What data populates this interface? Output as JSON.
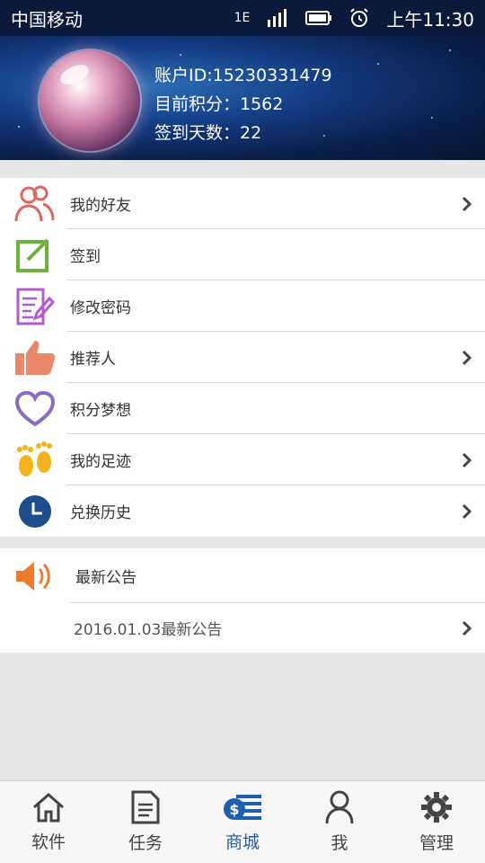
{
  "status_bar": {
    "carrier": "中国移动",
    "network": "1E",
    "time": "上午11:30"
  },
  "account": {
    "id_line": "账户ID:15230331479",
    "points_line": "目前积分：1562",
    "signin_days_line": "签到天数：22"
  },
  "menu": {
    "items": [
      {
        "label": "我的好友",
        "icon": "friends-icon",
        "chevron": true
      },
      {
        "label": "签到",
        "icon": "checkin-icon",
        "chevron": false
      },
      {
        "label": "修改密码",
        "icon": "edit-document-icon",
        "chevron": false
      },
      {
        "label": "推荐人",
        "icon": "thumbs-up-icon",
        "chevron": true
      },
      {
        "label": "积分梦想",
        "icon": "heart-icon",
        "chevron": false
      },
      {
        "label": "我的足迹",
        "icon": "footprints-icon",
        "chevron": true
      },
      {
        "label": "兑换历史",
        "icon": "clock-icon",
        "chevron": true
      }
    ]
  },
  "announcement": {
    "title": "最新公告",
    "latest": "2016.01.03最新公告"
  },
  "bottom_nav": {
    "items": [
      {
        "label": "软件",
        "icon": "home-icon"
      },
      {
        "label": "任务",
        "icon": "document-icon"
      },
      {
        "label": "商城",
        "icon": "shop-icon"
      },
      {
        "label": "我",
        "icon": "person-icon"
      },
      {
        "label": "管理",
        "icon": "gear-icon"
      }
    ],
    "active": "商城"
  },
  "colors": {
    "accent": "#1e5fb3",
    "friends": "#e0655f",
    "checkin": "#6bb33a",
    "edit": "#b25bd0",
    "thumb": "#e9896b",
    "heart": "#8c6ac0",
    "feet": "#f2b31c",
    "clock": "#1d4d8a",
    "speaker": "#ef7a2a"
  }
}
